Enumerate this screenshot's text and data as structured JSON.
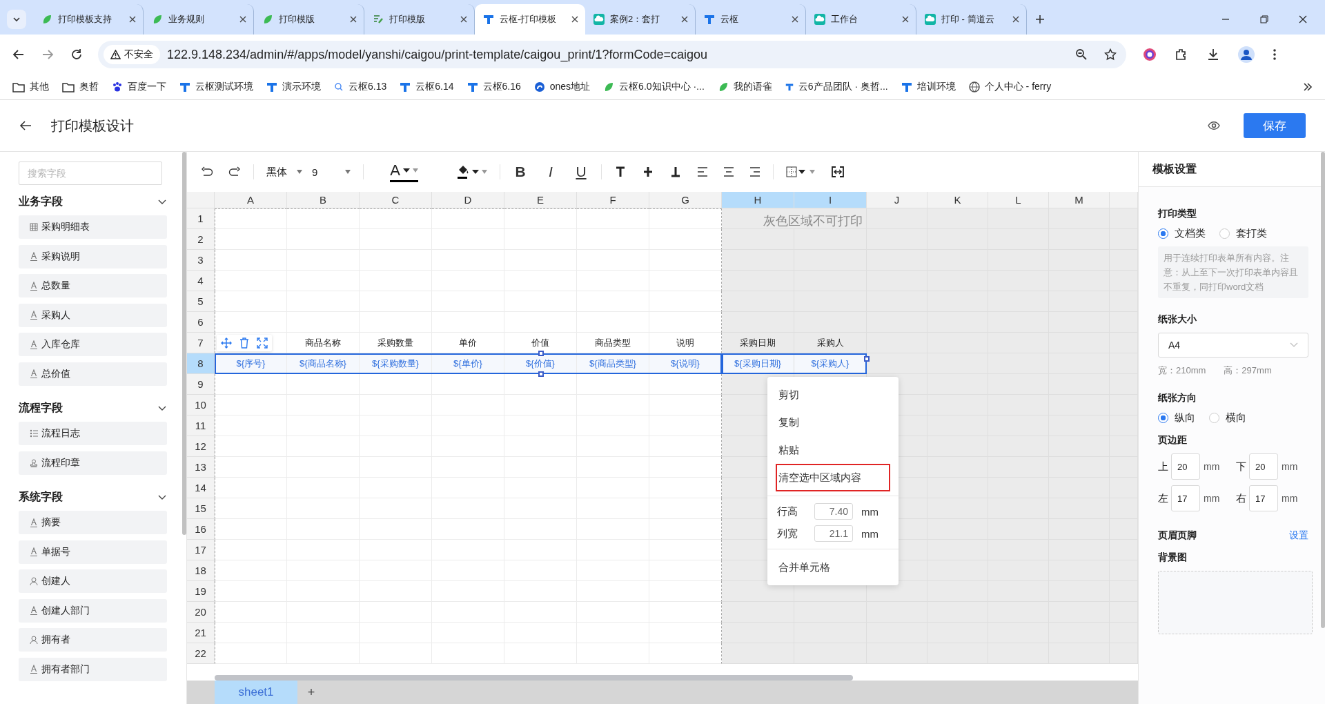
{
  "browser": {
    "tabs": [
      {
        "title": "打印模板支持",
        "kind": "leaf",
        "selected": false
      },
      {
        "title": "业务规则",
        "kind": "leaf",
        "selected": false
      },
      {
        "title": "打印模版",
        "kind": "leaf",
        "selected": false
      },
      {
        "title": "打印模版",
        "kind": "edit",
        "selected": false
      },
      {
        "title": "云枢-打印模板",
        "kind": "logo",
        "selected": true
      },
      {
        "title": "案例2：套打",
        "kind": "cloud",
        "selected": false
      },
      {
        "title": "云枢",
        "kind": "logo",
        "selected": false
      },
      {
        "title": "工作台",
        "kind": "cloud",
        "selected": false
      },
      {
        "title": "打印 - 简道云",
        "kind": "cloud",
        "selected": false
      }
    ],
    "security_label": "不安全",
    "url": "122.9.148.234/admin/#/apps/model/yanshi/caigou/print-template/caigou_print/1?formCode=caigou",
    "bookmarks": [
      {
        "label": "其他",
        "kind": "folder"
      },
      {
        "label": "奥哲",
        "kind": "folder"
      },
      {
        "label": "百度一下",
        "kind": "paw"
      },
      {
        "label": "云枢测试环境",
        "kind": "logo"
      },
      {
        "label": "演示环境",
        "kind": "logo"
      },
      {
        "label": "云枢6.13",
        "kind": "search"
      },
      {
        "label": "云枢6.14",
        "kind": "logo"
      },
      {
        "label": "云枢6.16",
        "kind": "logo"
      },
      {
        "label": "ones地址",
        "kind": "ones"
      },
      {
        "label": "云枢6.0知识中心 ·...",
        "kind": "leaf"
      },
      {
        "label": "我的语雀",
        "kind": "leaf"
      },
      {
        "label": "云6产品团队 · 奥哲...",
        "kind": "small-logo"
      },
      {
        "label": "培训环境",
        "kind": "logo"
      },
      {
        "label": "个人中心 - ferry",
        "kind": "globe"
      }
    ]
  },
  "header": {
    "title": "打印模板设计",
    "save_button": "保存"
  },
  "sidebar": {
    "search_placeholder": "搜索字段",
    "sections": [
      {
        "title": "业务字段",
        "expanded": true,
        "items": [
          {
            "label": "采购明细表",
            "kind": "table"
          },
          {
            "label": "采购说明",
            "kind": "text"
          },
          {
            "label": "总数量",
            "kind": "text"
          },
          {
            "label": "采购人",
            "kind": "text"
          },
          {
            "label": "入库仓库",
            "kind": "text"
          },
          {
            "label": "总价值",
            "kind": "text"
          }
        ]
      },
      {
        "title": "流程字段",
        "expanded": true,
        "items": [
          {
            "label": "流程日志",
            "kind": "list"
          },
          {
            "label": "流程印章",
            "kind": "stamp"
          }
        ]
      },
      {
        "title": "系统字段",
        "expanded": true,
        "items": [
          {
            "label": "摘要",
            "kind": "text"
          },
          {
            "label": "单据号",
            "kind": "text"
          },
          {
            "label": "创建人",
            "kind": "user"
          },
          {
            "label": "创建人部门",
            "kind": "text"
          },
          {
            "label": "拥有者",
            "kind": "user"
          },
          {
            "label": "拥有者部门",
            "kind": "text"
          }
        ]
      }
    ]
  },
  "toolbar": {
    "font": "黑体",
    "size": "9",
    "font_color_label": "A",
    "text_styles": [
      {
        "label": "B",
        "kind": "bold"
      },
      {
        "label": "I",
        "kind": "italic"
      },
      {
        "label": "U",
        "kind": "underline"
      }
    ]
  },
  "sheet": {
    "non_printable_label": "灰色区域不可打印",
    "columns": [
      {
        "label": "A",
        "selected": false,
        "printable": true
      },
      {
        "label": "B",
        "selected": false,
        "printable": true
      },
      {
        "label": "C",
        "selected": false,
        "printable": true
      },
      {
        "label": "D",
        "selected": false,
        "printable": true
      },
      {
        "label": "E",
        "selected": false,
        "printable": true
      },
      {
        "label": "F",
        "selected": false,
        "printable": true
      },
      {
        "label": "G",
        "selected": false,
        "printable": true
      },
      {
        "label": "H",
        "selected": true,
        "printable": false
      },
      {
        "label": "I",
        "selected": true,
        "printable": false
      },
      {
        "label": "J",
        "selected": false,
        "printable": false
      },
      {
        "label": "K",
        "selected": false,
        "printable": false
      },
      {
        "label": "L",
        "selected": false,
        "printable": false
      },
      {
        "label": "M",
        "selected": false,
        "printable": false
      }
    ],
    "rows": [
      {
        "number": "1",
        "selected": false
      },
      {
        "number": "2",
        "selected": false
      },
      {
        "number": "3",
        "selected": false
      },
      {
        "number": "4",
        "selected": false
      },
      {
        "number": "5",
        "selected": false
      },
      {
        "number": "6",
        "selected": false
      },
      {
        "number": "7",
        "selected": false,
        "cell_toolbar": true,
        "cells": [
          "商品名称",
          "采购数量",
          "单价",
          "价值",
          "商品类型",
          "说明",
          "采购日期",
          "采购人"
        ]
      },
      {
        "number": "8",
        "selected": true,
        "cells": [
          "${序号}",
          "${商品名称}",
          "${采购数量}",
          "${单价}",
          "${价值}",
          "${商品类型}",
          "${说明}",
          "${采购日期}",
          "${采购人}"
        ]
      },
      {
        "number": "9",
        "selected": false
      },
      {
        "number": "10",
        "selected": false
      },
      {
        "number": "11",
        "selected": false
      },
      {
        "number": "12",
        "selected": false
      },
      {
        "number": "13",
        "selected": false
      },
      {
        "number": "14",
        "selected": false
      },
      {
        "number": "15",
        "selected": false
      },
      {
        "number": "16",
        "selected": false
      },
      {
        "number": "17",
        "selected": false
      },
      {
        "number": "18",
        "selected": false
      },
      {
        "number": "19",
        "selected": false
      },
      {
        "number": "20",
        "selected": false
      },
      {
        "number": "21",
        "selected": false
      },
      {
        "number": "22",
        "selected": false
      }
    ],
    "sheet_tabs": [
      {
        "label": "sheet1",
        "selected": true
      }
    ],
    "add_sheet": "+",
    "context_menu": {
      "items": [
        {
          "kind": "action",
          "label": "剪切",
          "highlighted": false
        },
        {
          "kind": "action",
          "label": "复制",
          "highlighted": false
        },
        {
          "kind": "action",
          "label": "粘贴",
          "highlighted": false
        },
        {
          "kind": "action",
          "label": "清空选中区域内容",
          "highlighted": true
        },
        {
          "kind": "divider"
        },
        {
          "kind": "size",
          "label": "行高",
          "value": "7.40",
          "unit": "mm"
        },
        {
          "kind": "size",
          "label": "列宽",
          "value": "21.1",
          "unit": "mm"
        },
        {
          "kind": "divider"
        },
        {
          "kind": "action",
          "label": "合并单元格",
          "highlighted": false
        }
      ]
    }
  },
  "settings": {
    "title": "模板设置",
    "print_type": {
      "label": "打印类型",
      "options": [
        {
          "label": "文档类",
          "selected": true
        },
        {
          "label": "套打类",
          "selected": false
        }
      ],
      "note": "用于连续打印表单所有内容。注意：从上至下一次打印表单内容且不重复，同打印word文档"
    },
    "paper_size": {
      "label": "纸张大小",
      "value": "A4",
      "width": "宽：210mm",
      "height": "高：297mm"
    },
    "orientation": {
      "label": "纸张方向",
      "options": [
        {
          "label": "纵向",
          "selected": true
        },
        {
          "label": "横向",
          "selected": false
        }
      ]
    },
    "margins": {
      "label": "页边距",
      "fields": [
        {
          "label": "上",
          "value": "20",
          "unit": "mm"
        },
        {
          "label": "下",
          "value": "20",
          "unit": "mm"
        },
        {
          "label": "左",
          "value": "17",
          "unit": "mm"
        },
        {
          "label": "右",
          "value": "17",
          "unit": "mm"
        }
      ]
    },
    "header_footer": {
      "label": "页眉页脚",
      "link": "设置"
    },
    "background": {
      "label": "背景图"
    }
  }
}
